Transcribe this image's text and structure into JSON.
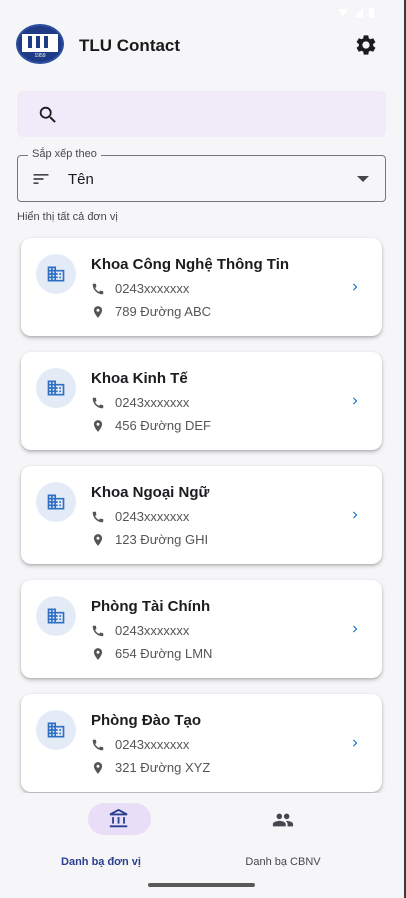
{
  "app": {
    "title": "TLU Contact",
    "logo_year": "1959"
  },
  "search": {
    "placeholder": ""
  },
  "sort": {
    "label": "Sắp xếp theo",
    "value": "Tên"
  },
  "helper_text": "Hiển thị tất cả đơn vị",
  "units": [
    {
      "name": "Khoa Công Nghệ Thông Tin",
      "phone": "0243xxxxxxx",
      "address": "789 Đường ABC"
    },
    {
      "name": "Khoa Kinh Tế",
      "phone": "0243xxxxxxx",
      "address": "456 Đường DEF"
    },
    {
      "name": "Khoa Ngoại Ngữ",
      "phone": "0243xxxxxxx",
      "address": "123 Đường GHI"
    },
    {
      "name": "Phòng Tài Chính",
      "phone": "0243xxxxxxx",
      "address": "654 Đường LMN"
    },
    {
      "name": "Phòng Đào Tạo",
      "phone": "0243xxxxxxx",
      "address": "321 Đường XYZ"
    }
  ],
  "bottom_nav": {
    "items": [
      {
        "label": "Danh bạ đơn vị",
        "icon": "bank-icon",
        "active": true
      },
      {
        "label": "Danh bạ CBNV",
        "icon": "people-icon",
        "active": false
      }
    ]
  },
  "colors": {
    "accent": "#2a3f8f",
    "avatar_bg": "#e3ecf6",
    "building_icon": "#2f6fc4",
    "chevron": "#1976d2",
    "search_bg": "#f1eaf8",
    "nav_pill": "#e8def8"
  }
}
